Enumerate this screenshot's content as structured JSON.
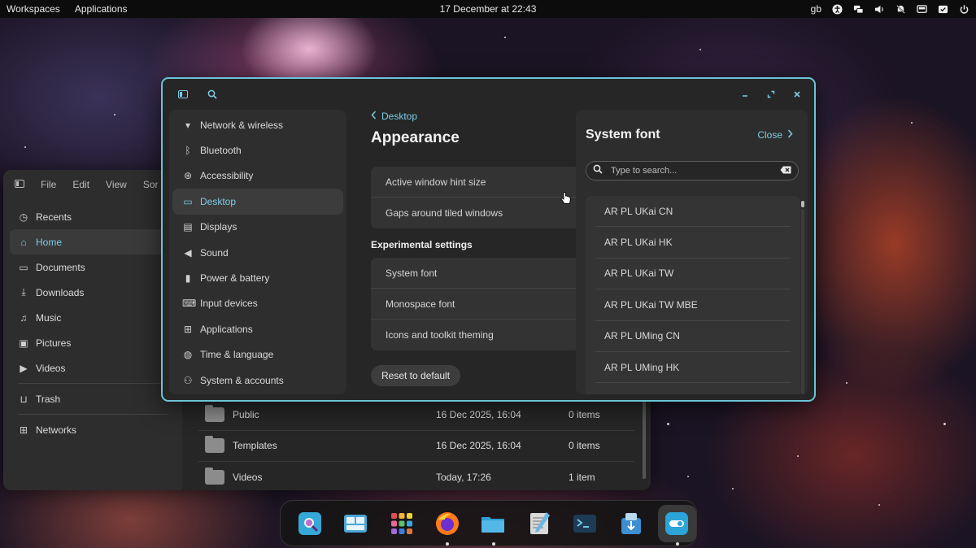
{
  "topbar": {
    "workspaces": "Workspaces",
    "applications": "Applications",
    "datetime": "17 December at 22:43",
    "keyboard_layout": "gb",
    "tray_icons": [
      "accessibility-icon",
      "network-icon",
      "volume-icon",
      "notifications-off-icon",
      "display-icon",
      "battery-icon",
      "power-icon"
    ]
  },
  "files": {
    "menu": [
      "File",
      "Edit",
      "View",
      "Sor"
    ],
    "sidebar": [
      {
        "label": "Recents",
        "icon": "clock-icon"
      },
      {
        "label": "Home",
        "icon": "home-icon",
        "active": true
      },
      {
        "label": "Documents",
        "icon": "document-icon"
      },
      {
        "label": "Downloads",
        "icon": "download-icon"
      },
      {
        "label": "Music",
        "icon": "music-icon"
      },
      {
        "label": "Pictures",
        "icon": "picture-icon"
      },
      {
        "label": "Videos",
        "icon": "video-icon"
      },
      {
        "label": "Trash",
        "icon": "trash-icon"
      },
      {
        "label": "Networks",
        "icon": "network-icon"
      }
    ],
    "rows": [
      {
        "name": "Public",
        "modified": "16 Dec 2025, 16:04",
        "size": "0 items"
      },
      {
        "name": "Templates",
        "modified": "16 Dec 2025, 16:04",
        "size": "0 items"
      },
      {
        "name": "Videos",
        "modified": "Today, 17:26",
        "size": "1 item"
      }
    ]
  },
  "settings": {
    "sidebar": [
      {
        "label": "Network & wireless",
        "icon": "wifi-icon"
      },
      {
        "label": "Bluetooth",
        "icon": "bluetooth-icon"
      },
      {
        "label": "Accessibility",
        "icon": "accessibility-icon"
      },
      {
        "label": "Desktop",
        "icon": "monitor-icon",
        "active": true
      },
      {
        "label": "Displays",
        "icon": "display-icon"
      },
      {
        "label": "Sound",
        "icon": "speaker-icon"
      },
      {
        "label": "Power & battery",
        "icon": "battery-icon"
      },
      {
        "label": "Input devices",
        "icon": "keyboard-icon"
      },
      {
        "label": "Applications",
        "icon": "apps-grid-icon"
      },
      {
        "label": "Time & language",
        "icon": "globe-icon"
      },
      {
        "label": "System & accounts",
        "icon": "users-icon"
      }
    ],
    "back_label": "Desktop",
    "page_title": "Appearance",
    "card1": [
      "Active window hint size",
      "Gaps around tiled windows"
    ],
    "experimental_heading": "Experimental settings",
    "card2": [
      "System font",
      "Monospace font",
      "Icons and toolkit theming"
    ],
    "reset_label": "Reset to default"
  },
  "font_panel": {
    "title": "System font",
    "close_label": "Close",
    "search_placeholder": "Type to search...",
    "fonts": [
      "AR PL UKai CN",
      "AR PL UKai HK",
      "AR PL UKai TW",
      "AR PL UKai TW MBE",
      "AR PL UMing CN",
      "AR PL UMing HK"
    ]
  },
  "dock": {
    "apps": [
      {
        "name": "app-store",
        "color": "#36a8d8",
        "accent": "#c06bd0"
      },
      {
        "name": "workspaces",
        "color": "#4aa7d8",
        "accent": "#e8f4fb"
      },
      {
        "name": "app-library",
        "color": "#e04e4e",
        "accent": "#f2b43a"
      },
      {
        "name": "firefox",
        "color": "#ff7a1a",
        "accent": "#6c2fd1",
        "running": true
      },
      {
        "name": "files",
        "color": "#2e9ed6",
        "accent": "#7fd0f0",
        "running": true
      },
      {
        "name": "text-editor",
        "color": "#d9d9d9",
        "accent": "#6bb8e0"
      },
      {
        "name": "terminal",
        "color": "#1d3b55",
        "accent": "#6fc3e0"
      },
      {
        "name": "installer",
        "color": "#3c8fd0",
        "accent": "#b7d9f0"
      },
      {
        "name": "settings",
        "color": "#2ba4d8",
        "accent": "#ffffff",
        "running": true,
        "active": true
      }
    ]
  }
}
